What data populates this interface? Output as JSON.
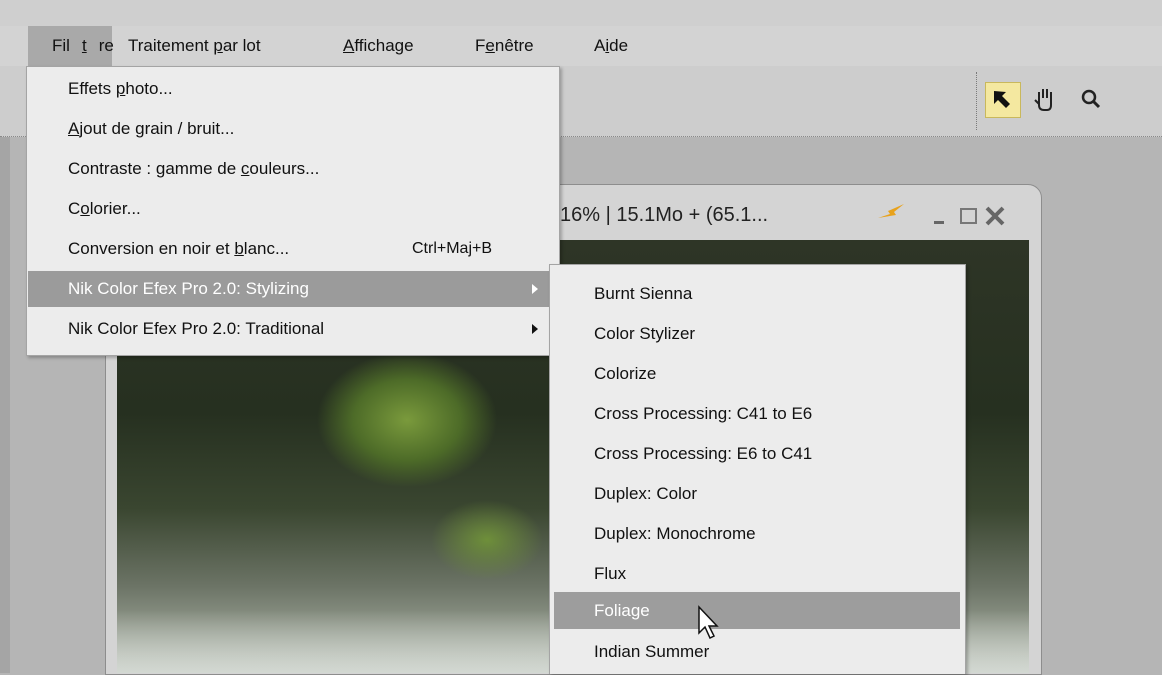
{
  "menubar": {
    "items": [
      {
        "pre": "Fil",
        "ul": "t",
        "post": "re"
      },
      {
        "pre": "Traitement ",
        "ul": "p",
        "post": "ar lot"
      },
      {
        "pre": "",
        "ul": "A",
        "post": "ffichage"
      },
      {
        "pre": "F",
        "ul": "e",
        "post": "nêtre"
      },
      {
        "pre": "A",
        "ul": "i",
        "post": "de"
      }
    ]
  },
  "document": {
    "title": "16%  |  15.1Mo  +  (65.1..."
  },
  "filtre_menu": {
    "items": [
      {
        "pre": "Effets ",
        "ul": "p",
        "post": "hoto..."
      },
      {
        "pre": "",
        "ul": "A",
        "post": "jout de grain / bruit..."
      },
      {
        "pre": "Contraste : gamme de ",
        "ul": "c",
        "post": "ouleurs..."
      },
      {
        "pre": "C",
        "ul": "o",
        "post": "lorier..."
      },
      {
        "pre": "Conversion en noir et ",
        "ul": "b",
        "post": "lanc...",
        "shortcut": "Ctrl+Maj+B"
      },
      {
        "pre": "Nik Color Efex Pro 2.0: Stylizing",
        "ul": "",
        "post": ""
      },
      {
        "pre": "Nik Color Efex Pro 2.0: Traditional",
        "ul": "",
        "post": ""
      }
    ]
  },
  "stylizing_submenu": {
    "items": [
      "Burnt Sienna",
      "Color Stylizer",
      "Colorize",
      "Cross Processing: C41 to E6",
      "Cross Processing: E6 to C41",
      "Duplex: Color",
      "Duplex: Monochrome",
      "Flux",
      "Foliage",
      "Indian Summer"
    ],
    "highlighted": "Foliage"
  },
  "icons": {
    "arrow_tool": "arrow-pointer-icon",
    "hand_tool": "hand-icon",
    "zoom_tool": "magnifier-icon",
    "minimize": "minimize-icon",
    "maximize": "maximize-icon",
    "close": "close-icon"
  },
  "colors": {
    "menu_highlight": "#9b9b9b",
    "menu_bg": "#ececec",
    "tool_active": "#f4e8a0",
    "speed_icon": "#e8a21c"
  }
}
